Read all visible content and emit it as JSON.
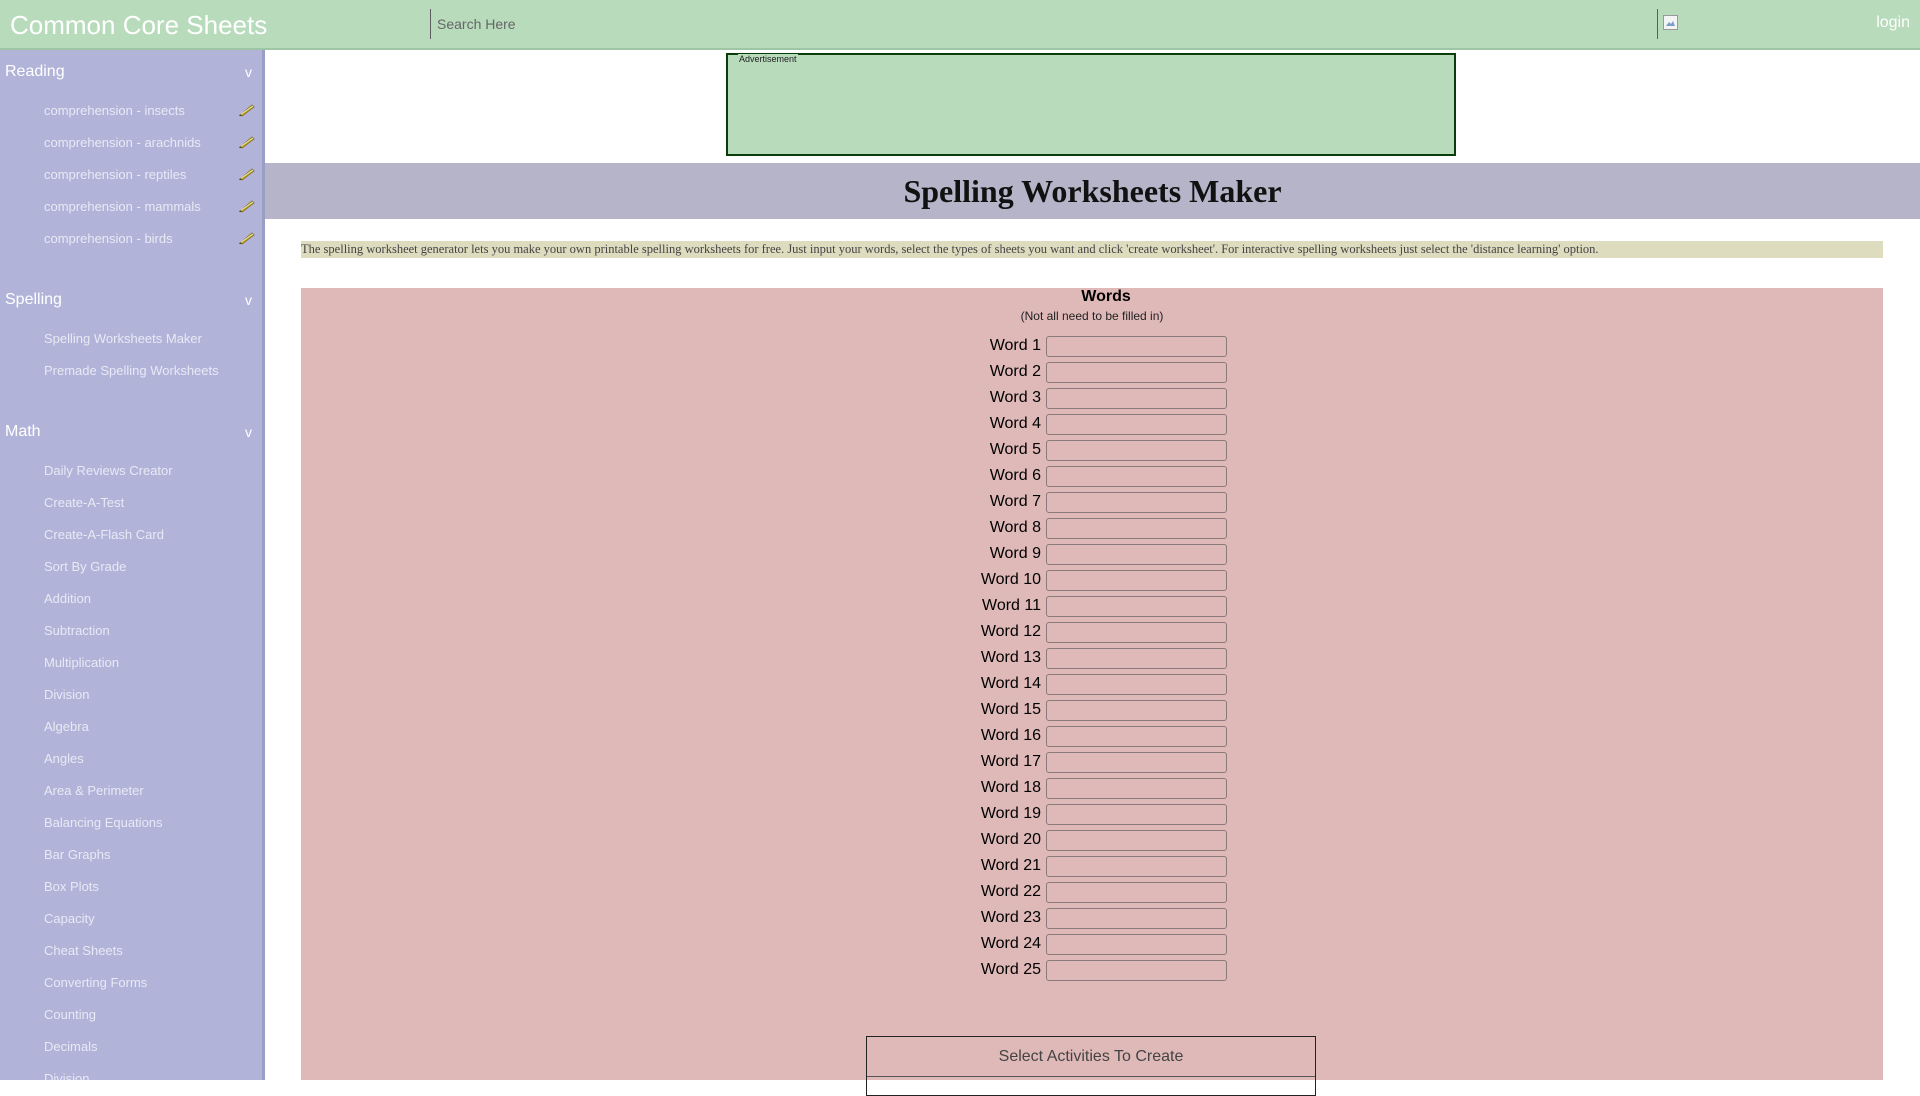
{
  "header": {
    "brand": "Common Core Sheets",
    "search_placeholder": "Search Here",
    "login_label": "login"
  },
  "sidebar": {
    "reading": {
      "title": "Reading",
      "chevron": "v",
      "items": [
        {
          "label": "comprehension - insects",
          "icon": "pencil-icon"
        },
        {
          "label": "comprehension - arachnids",
          "icon": "pencil-icon"
        },
        {
          "label": "comprehension - reptiles",
          "icon": "pencil-icon"
        },
        {
          "label": "comprehension - mammals",
          "icon": "pencil-icon"
        },
        {
          "label": "comprehension - birds",
          "icon": "pencil-icon"
        }
      ]
    },
    "spelling": {
      "title": "Spelling",
      "chevron": "v",
      "items": [
        "Spelling Worksheets Maker",
        "Premade Spelling Worksheets"
      ]
    },
    "math": {
      "title": "Math",
      "chevron": "v",
      "items": [
        "Daily Reviews Creator",
        "Create-A-Test",
        "Create-A-Flash Card",
        "Sort By Grade",
        "Addition",
        "Subtraction",
        "Multiplication",
        "Division",
        "Algebra",
        "Angles",
        "Area & Perimeter",
        "Balancing Equations",
        "Bar Graphs",
        "Box Plots",
        "Capacity",
        "Cheat Sheets",
        "Converting Forms",
        "Counting",
        "Decimals",
        "Division"
      ]
    }
  },
  "main": {
    "ad_label": "Advertisement",
    "title": "Spelling Worksheets Maker",
    "intro": "The spelling worksheet generator lets you make your own printable spelling worksheets for free. Just input your words, select the types of sheets you want and click 'create worksheet'. For interactive spelling worksheets just select the 'distance learning' option.",
    "words_title": "Words",
    "words_subtitle": "(Not all need to be filled in)",
    "word_labels": [
      "Word 1",
      "Word 2",
      "Word 3",
      "Word 4",
      "Word 5",
      "Word 6",
      "Word 7",
      "Word 8",
      "Word 9",
      "Word 10",
      "Word 11",
      "Word 12",
      "Word 13",
      "Word 14",
      "Word 15",
      "Word 16",
      "Word 17",
      "Word 18",
      "Word 19",
      "Word 20",
      "Word 21",
      "Word 22",
      "Word 23",
      "Word 24",
      "Word 25"
    ],
    "activities_title": "Select Activities To Create"
  },
  "colors": {
    "header_bg": "#b8dbbc",
    "sidebar_bg": "#b1b4d8",
    "title_band": "#b5b4c8",
    "words_panel": "#dfb8b8",
    "intro_bg": "#dedcbf"
  }
}
